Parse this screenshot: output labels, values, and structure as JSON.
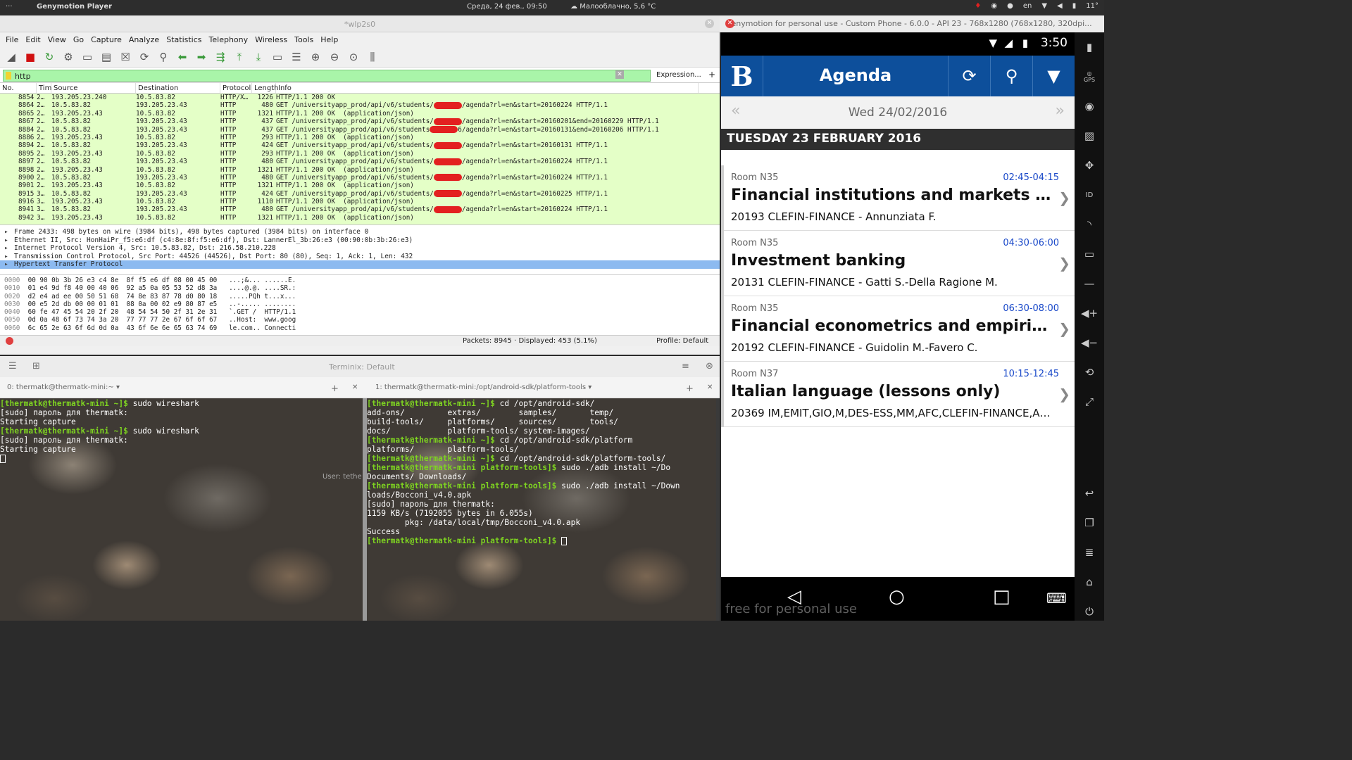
{
  "topbar": {
    "menu": "···",
    "app": "Genymotion Player",
    "date": "Среда, 24 фев., 09:50",
    "weather": "Малооблачно, 5,6 °C",
    "lang": "en",
    "temp": "11°"
  },
  "wireshark": {
    "title": "*wlp2s0",
    "menu": [
      "File",
      "Edit",
      "View",
      "Go",
      "Capture",
      "Analyze",
      "Statistics",
      "Telephony",
      "Wireless",
      "Tools",
      "Help"
    ],
    "toolbar_icons": [
      "shark-fin-icon",
      "stop-icon",
      "restart-icon",
      "options-gear-icon",
      "open-folder-icon",
      "save-icon",
      "close-file-icon",
      "reload-icon",
      "find-icon",
      "back-arrow-icon",
      "forward-arrow-icon",
      "goto-packet-icon",
      "first-packet-icon",
      "last-packet-icon",
      "autoscroll-icon",
      "colorize-icon",
      "zoom-in-icon",
      "zoom-out-icon",
      "zoom-reset-icon",
      "resize-columns-icon"
    ],
    "filter": "http",
    "expression_label": "Expression...",
    "columns": [
      "No.",
      "Tim",
      "Source",
      "Destination",
      "Protocol",
      "Length",
      "Info"
    ],
    "packets": [
      {
        "no": "8854",
        "time": "2…",
        "src": "193.205.23.240",
        "dst": "10.5.83.82",
        "proto": "HTTP/X…",
        "len": "1226",
        "info": "HTTP/1.1 200 OK",
        "redact": false
      },
      {
        "no": "8864",
        "time": "2…",
        "src": "10.5.83.82",
        "dst": "193.205.23.43",
        "proto": "HTTP",
        "len": "480",
        "info": "GET /universityapp_prod/api/v6/students/",
        "info2": "/agenda?rl=en&start=20160224 HTTP/1.1",
        "redact": true
      },
      {
        "no": "8865",
        "time": "2…",
        "src": "193.205.23.43",
        "dst": "10.5.83.82",
        "proto": "HTTP",
        "len": "1321",
        "info": "HTTP/1.1 200 OK  (application/json)",
        "redact": false
      },
      {
        "no": "8867",
        "time": "2…",
        "src": "10.5.83.82",
        "dst": "193.205.23.43",
        "proto": "HTTP",
        "len": "437",
        "info": "GET /universityapp_prod/api/v6/students/",
        "info2": "/agenda?rl=en&start=20160201&end=20160229 HTTP/1.1",
        "redact": true
      },
      {
        "no": "8884",
        "time": "2…",
        "src": "10.5.83.82",
        "dst": "193.205.23.43",
        "proto": "HTTP",
        "len": "437",
        "info": "GET /universityapp_prod/api/v6/students",
        "info2": "6/agenda?rl=en&start=20160131&end=20160206 HTTP/1.1",
        "redact": true
      },
      {
        "no": "8886",
        "time": "2…",
        "src": "193.205.23.43",
        "dst": "10.5.83.82",
        "proto": "HTTP",
        "len": "293",
        "info": "HTTP/1.1 200 OK  (application/json)",
        "redact": false
      },
      {
        "no": "8894",
        "time": "2…",
        "src": "10.5.83.82",
        "dst": "193.205.23.43",
        "proto": "HTTP",
        "len": "424",
        "info": "GET /universityapp_prod/api/v6/students/",
        "info2": "/agenda?rl=en&start=20160131 HTTP/1.1",
        "redact": true
      },
      {
        "no": "8895",
        "time": "2…",
        "src": "193.205.23.43",
        "dst": "10.5.83.82",
        "proto": "HTTP",
        "len": "293",
        "info": "HTTP/1.1 200 OK  (application/json)",
        "redact": false
      },
      {
        "no": "8897",
        "time": "2…",
        "src": "10.5.83.82",
        "dst": "193.205.23.43",
        "proto": "HTTP",
        "len": "480",
        "info": "GET /universityapp_prod/api/v6/students/",
        "info2": "/agenda?rl=en&start=20160224 HTTP/1.1",
        "redact": true
      },
      {
        "no": "8898",
        "time": "2…",
        "src": "193.205.23.43",
        "dst": "10.5.83.82",
        "proto": "HTTP",
        "len": "1321",
        "info": "HTTP/1.1 200 OK  (application/json)",
        "redact": false
      },
      {
        "no": "8900",
        "time": "2…",
        "src": "10.5.83.82",
        "dst": "193.205.23.43",
        "proto": "HTTP",
        "len": "480",
        "info": "GET /universityapp_prod/api/v6/students/",
        "info2": "/agenda?rl=en&start=20160224 HTTP/1.1",
        "redact": true
      },
      {
        "no": "8901",
        "time": "2…",
        "src": "193.205.23.43",
        "dst": "10.5.83.82",
        "proto": "HTTP",
        "len": "1321",
        "info": "HTTP/1.1 200 OK  (application/json)",
        "redact": false
      },
      {
        "no": "8915",
        "time": "3…",
        "src": "10.5.83.82",
        "dst": "193.205.23.43",
        "proto": "HTTP",
        "len": "424",
        "info": "GET /universityapp_prod/api/v6/students/",
        "info2": "/agenda?rl=en&start=20160225 HTTP/1.1",
        "redact": true
      },
      {
        "no": "8916",
        "time": "3…",
        "src": "193.205.23.43",
        "dst": "10.5.83.82",
        "proto": "HTTP",
        "len": "1110",
        "info": "HTTP/1.1 200 OK  (application/json)",
        "redact": false
      },
      {
        "no": "8941",
        "time": "3…",
        "src": "10.5.83.82",
        "dst": "193.205.23.43",
        "proto": "HTTP",
        "len": "480",
        "info": "GET /universityapp_prod/api/v6/students/",
        "info2": "/agenda?rl=en&start=20160224 HTTP/1.1",
        "redact": true
      },
      {
        "no": "8942",
        "time": "3…",
        "src": "193.205.23.43",
        "dst": "10.5.83.82",
        "proto": "HTTP",
        "len": "1321",
        "info": "HTTP/1.1 200 OK  (application/json)",
        "redact": false
      }
    ],
    "details": [
      "Frame 2433: 498 bytes on wire (3984 bits), 498 bytes captured (3984 bits) on interface 0",
      "Ethernet II, Src: HonHaiPr_f5:e6:df (c4:8e:8f:f5:e6:df), Dst: LannerEl_3b:26:e3 (00:90:0b:3b:26:e3)",
      "Internet Protocol Version 4, Src: 10.5.83.82, Dst: 216.58.210.228",
      "Transmission Control Protocol, Src Port: 44526 (44526), Dst Port: 80 (80), Seq: 1, Ack: 1, Len: 432",
      "Hypertext Transfer Protocol"
    ],
    "hex": [
      {
        "off": "0000",
        "bytes": "00 90 0b 3b 26 e3 c4 8e  8f f5 e6 df 08 00 45 00",
        "ascii": "...;&... ......E."
      },
      {
        "off": "0010",
        "bytes": "01 e4 9d f8 40 00 40 06  92 a5 0a 05 53 52 d8 3a",
        "ascii": "....@.@. ....SR.:"
      },
      {
        "off": "0020",
        "bytes": "d2 e4 ad ee 00 50 51 68  74 8e 83 87 78 d0 80 18",
        "ascii": ".....PQh t...x..."
      },
      {
        "off": "0030",
        "bytes": "00 e5 2d db 00 00 01 01  08 0a 00 02 e9 80 87 e5",
        "ascii": "..-..... ........"
      },
      {
        "off": "0040",
        "bytes": "60 fe 47 45 54 20 2f 20  48 54 54 50 2f 31 2e 31",
        "ascii": "`.GET /  HTTP/1.1"
      },
      {
        "off": "0050",
        "bytes": "0d 0a 48 6f 73 74 3a 20  77 77 77 2e 67 6f 6f 67",
        "ascii": "..Host:  www.goog"
      },
      {
        "off": "0060",
        "bytes": "6c 65 2e 63 6f 6d 0d 0a  43 6f 6e 6e 65 63 74 69",
        "ascii": "le.com.. Connecti"
      }
    ],
    "status_packets": "Packets: 8945 · Displayed: 453 (5.1%)",
    "status_profile": "Profile: Default"
  },
  "terminix": {
    "title": "Terminix: Default",
    "tab_left": "0: thermatk@thermatk-mini:~",
    "tab_right": "1: thermatk@thermatk-mini:/opt/android-sdk/platform-tools",
    "user_hint": "User: tethe",
    "left_lines": [
      {
        "p": "[thermatk@thermatk-mini ~]$",
        "t": " sudo wireshark"
      },
      {
        "p": "",
        "t": "[sudo] пароль для thermatk:"
      },
      {
        "p": "",
        "t": "Starting capture"
      },
      {
        "p": "[thermatk@thermatk-mini ~]$",
        "t": " sudo wireshark"
      },
      {
        "p": "",
        "t": "[sudo] пароль для thermatk:"
      },
      {
        "p": "",
        "t": "Starting capture"
      }
    ],
    "right_lines": [
      {
        "p": "[thermatk@thermatk-mini ~]$",
        "t": " cd /opt/android-sdk/"
      },
      {
        "p": "",
        "t": "add-ons/         extras/        samples/       temp/"
      },
      {
        "p": "",
        "t": "build-tools/     platforms/     sources/       tools/"
      },
      {
        "p": "",
        "t": "docs/            platform-tools/ system-images/"
      },
      {
        "p": "[thermatk@thermatk-mini ~]$",
        "t": " cd /opt/android-sdk/platform"
      },
      {
        "p": "",
        "t": "platforms/       platform-tools/"
      },
      {
        "p": "[thermatk@thermatk-mini ~]$",
        "t": " cd /opt/android-sdk/platform-tools/"
      },
      {
        "p": "[thermatk@thermatk-mini platform-tools]$",
        "t": " sudo ./adb install ~/Do"
      },
      {
        "p": "",
        "t": "Documents/ Downloads/"
      },
      {
        "p": "[thermatk@thermatk-mini platform-tools]$",
        "t": " sudo ./adb install ~/Down"
      },
      {
        "p": "",
        "t": "loads/Bocconi_v4.0.apk"
      },
      {
        "p": "",
        "t": "[sudo] пароль для thermatk:"
      },
      {
        "p": "",
        "t": "1159 KB/s (7192055 bytes in 6.055s)"
      },
      {
        "p": "",
        "t": "        pkg: /data/local/tmp/Bocconi_v4.0.apk"
      },
      {
        "p": "",
        "t": "Success"
      },
      {
        "p": "[thermatk@thermatk-mini platform-tools]$",
        "t": " "
      }
    ]
  },
  "genymotion": {
    "title": "Genymotion for personal use - Custom Phone - 6.0.0 - API 23 - 768x1280 (768x1280, 320dpi...",
    "phone_time": "3:50",
    "app_logo": "B",
    "app_title": "Agenda",
    "current_date": "Wed 24/02/2016",
    "day_header": "TUESDAY 23 FEBRUARY 2016",
    "watermark": "free for personal use",
    "events": [
      {
        "room": "Room N35",
        "time": "02:45-04:15",
        "name": "Financial institutions and markets law",
        "sub": "20193 CLEFIN-FINANCE - Annunziata F."
      },
      {
        "room": "Room N35",
        "time": "04:30-06:00",
        "name": "Investment banking",
        "sub": "20131 CLEFIN-FINANCE - Gatti S.-Della Ragione M."
      },
      {
        "room": "Room N35",
        "time": "06:30-08:00",
        "name": "Financial econometrics and empirical fina…",
        "sub": "20192 CLEFIN-FINANCE - Guidolin M.-Favero C."
      },
      {
        "room": "Room N37",
        "time": "10:15-12:45",
        "name": "Italian language (lessons only)",
        "sub": "20369 IM,EMIT,GIO,M,DES-ESS,MM,AFC,CLEFIN-FINANCE,A…"
      }
    ],
    "side_labels": {
      "gps": "GPS",
      "id": "ID"
    }
  }
}
